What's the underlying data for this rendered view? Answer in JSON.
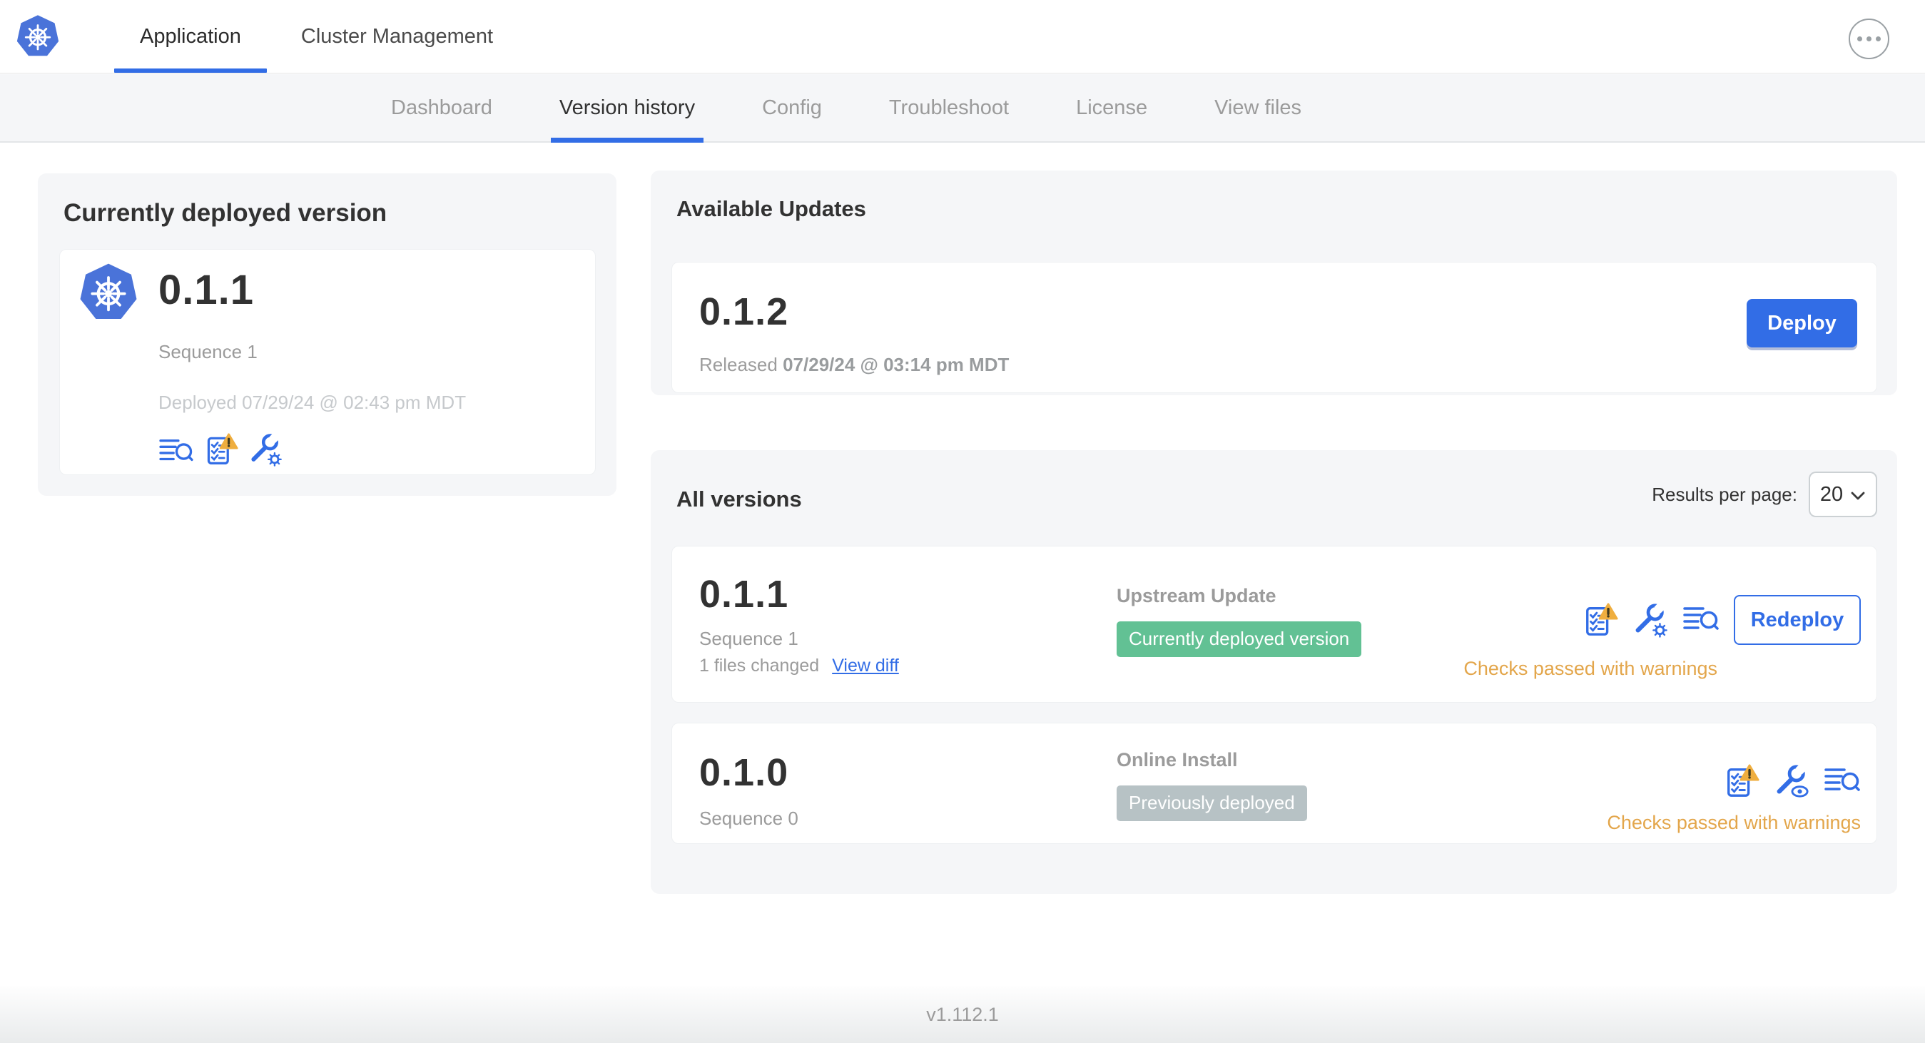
{
  "header": {
    "tabs": [
      {
        "label": "Application"
      },
      {
        "label": "Cluster Management"
      }
    ]
  },
  "subnav": {
    "items": [
      {
        "label": "Dashboard"
      },
      {
        "label": "Version history"
      },
      {
        "label": "Config"
      },
      {
        "label": "Troubleshoot"
      },
      {
        "label": "License"
      },
      {
        "label": "View files"
      }
    ]
  },
  "current_version": {
    "title": "Currently deployed version",
    "version": "0.1.1",
    "sequence": "Sequence 1",
    "deployed": "Deployed 07/29/24 @ 02:43 pm MDT"
  },
  "available_updates": {
    "title": "Available Updates",
    "version": "0.1.2",
    "released_label": "Released",
    "released_date": "07/29/24 @ 03:14 pm MDT",
    "deploy_button": "Deploy"
  },
  "all_versions": {
    "title": "All versions",
    "results_per_page_label": "Results per page:",
    "results_per_page_value": "20",
    "rows": [
      {
        "version": "0.1.1",
        "sequence": "Sequence 1",
        "files_changed": "1 files changed",
        "view_diff_link": "View diff",
        "source": "Upstream Update",
        "badge": "Currently deployed version",
        "status": "Checks passed with warnings",
        "action_button": "Redeploy"
      },
      {
        "version": "0.1.0",
        "sequence": "Sequence 0",
        "source": "Online Install",
        "badge": "Previously deployed",
        "status": "Checks passed with warnings"
      }
    ]
  },
  "footer": {
    "app_version": "v1.112.1"
  },
  "colors": {
    "accent_blue": "#326de6",
    "logo_blue": "#4a73d9",
    "badge_green": "#62c194",
    "badge_gray": "#b7c2c5",
    "warning_amber": "#e3a64b",
    "card_bg": "#f5f6f8"
  }
}
